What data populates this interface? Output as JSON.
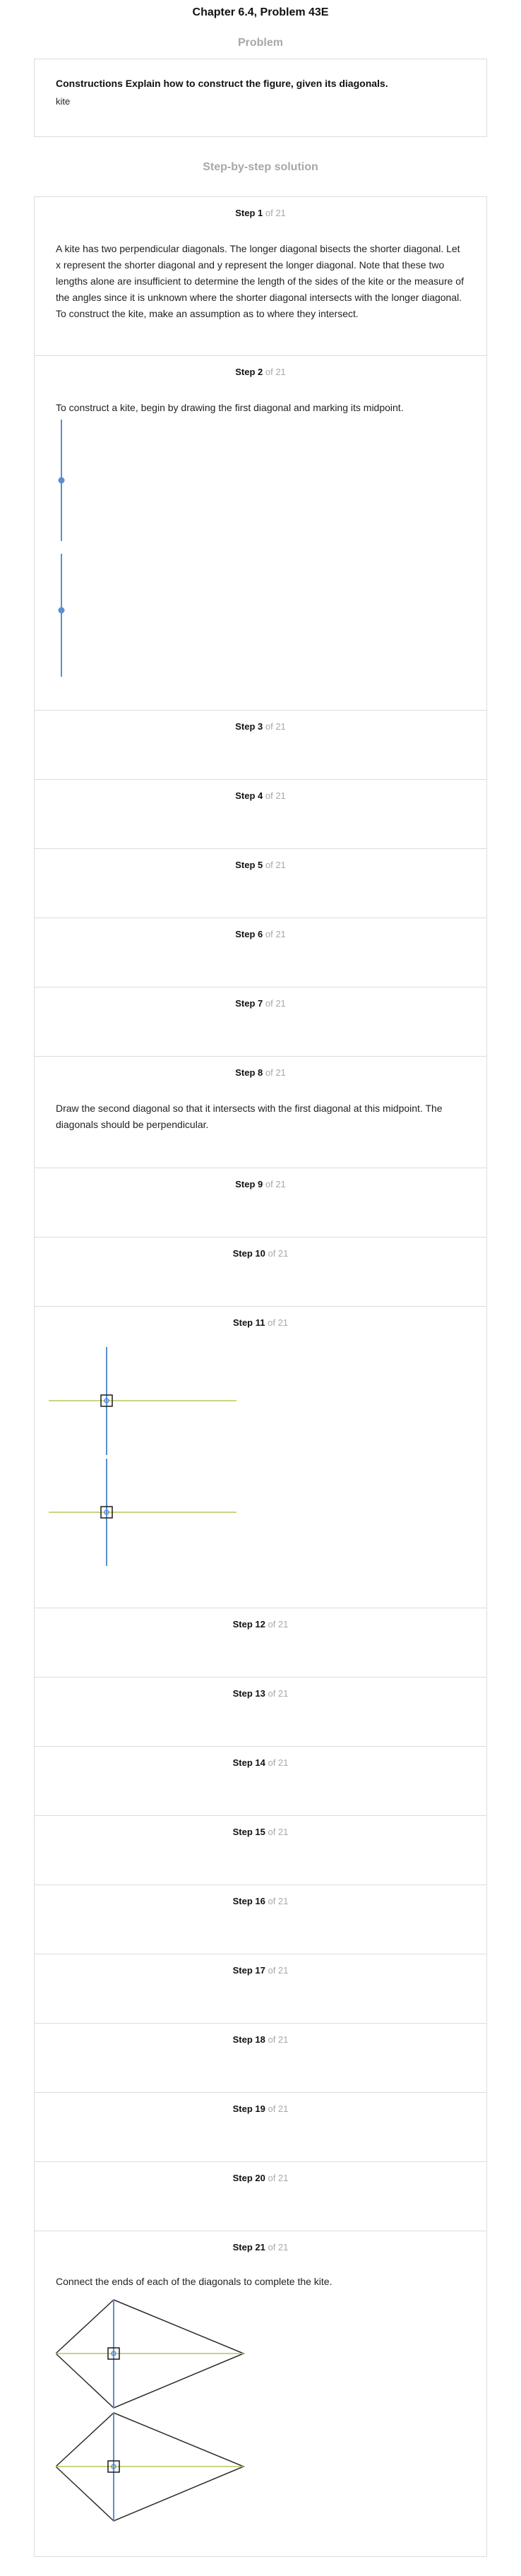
{
  "header": {
    "chapter_title": "Chapter 6.4, Problem 43E",
    "problem_heading": "Problem",
    "solution_heading": "Step-by-step solution"
  },
  "problem": {
    "statement": "Constructions Explain how to construct the figure, given its diagonals.",
    "figure_name": "kite"
  },
  "steps": [
    {
      "label": "Step 1",
      "of": "of 21",
      "text": "A kite has two perpendicular diagonals. The longer diagonal bisects the shorter diagonal. Let x represent the shorter diagonal and y represent the longer diagonal. Note that these two lengths alone are insufficient to determine the length of the sides of the kite or the measure of the angles since it is unknown where the shorter diagonal intersects with the longer diagonal. To construct the kite, make an assumption as to where they intersect."
    },
    {
      "label": "Step 2",
      "of": "of 21",
      "text": "To construct a kite, begin by drawing the first diagonal and marking its midpoint."
    },
    {
      "label": "Step 3",
      "of": "of 21"
    },
    {
      "label": "Step 4",
      "of": "of 21"
    },
    {
      "label": "Step 5",
      "of": "of 21"
    },
    {
      "label": "Step 6",
      "of": "of 21"
    },
    {
      "label": "Step 7",
      "of": "of 21"
    },
    {
      "label": "Step 8",
      "of": "of 21",
      "text": "Draw the second diagonal so that it intersects with the first diagonal at this midpoint. The diagonals should be perpendicular."
    },
    {
      "label": "Step 9",
      "of": "of 21"
    },
    {
      "label": "Step 10",
      "of": "of 21"
    },
    {
      "label": "Step 11",
      "of": "of 21"
    },
    {
      "label": "Step 12",
      "of": "of 21"
    },
    {
      "label": "Step 13",
      "of": "of 21"
    },
    {
      "label": "Step 14",
      "of": "of 21"
    },
    {
      "label": "Step 15",
      "of": "of 21"
    },
    {
      "label": "Step 16",
      "of": "of 21"
    },
    {
      "label": "Step 17",
      "of": "of 21"
    },
    {
      "label": "Step 18",
      "of": "of 21"
    },
    {
      "label": "Step 19",
      "of": "of 21"
    },
    {
      "label": "Step 20",
      "of": "of 21"
    },
    {
      "label": "Step 21",
      "of": "of 21",
      "text": "Connect the ends of each of the diagonals to complete the kite."
    }
  ],
  "colors": {
    "diagonal_blue": "#5b8fd0",
    "diagonal_green": "#b6c75a",
    "kite_outline": "#2b2b2b",
    "border": "#dcdcdc",
    "muted": "#a8a8a8"
  }
}
